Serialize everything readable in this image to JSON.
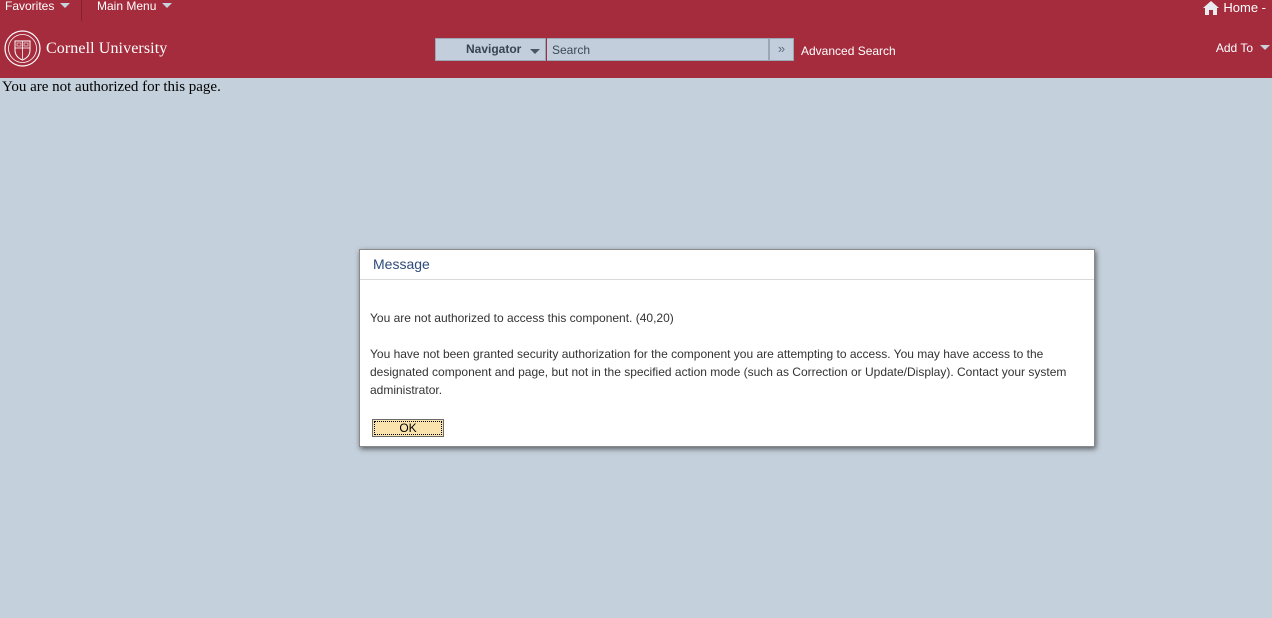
{
  "topbar": {
    "favorites_label": "Favorites",
    "main_menu_label": "Main Menu",
    "home_label": "Home -",
    "university_name": "Cornell University",
    "navigator_label": "Navigator",
    "search_placeholder": "Search",
    "search_go_icon": "double-chevron-right-icon",
    "advanced_search_label": "Advanced Search",
    "add_to_label": "Add To"
  },
  "page": {
    "error_text": "You are not authorized for this page."
  },
  "dialog": {
    "title": "Message",
    "message_line1": "You are not authorized to access this component. (40,20)",
    "message_line2": "You have not been granted security authorization for the component you are attempting to access. You may have access to the designated component and page, but not in the specified action mode (such as Correction or Update/Display).  Contact your system administrator.",
    "ok_label": "OK"
  },
  "colors": {
    "header_bg": "#a52c3d",
    "page_bg": "#c4d0db",
    "dialog_title": "#2e4a7a",
    "ok_button_bg": "#fbe3ad"
  }
}
